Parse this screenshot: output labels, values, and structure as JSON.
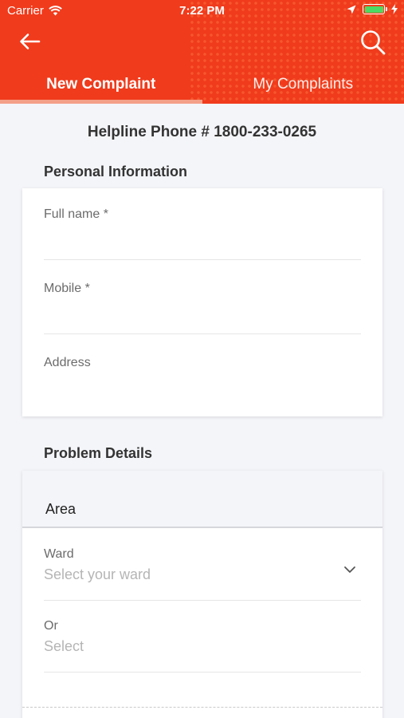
{
  "status_bar": {
    "carrier": "Carrier",
    "time": "7:22 PM",
    "icons": [
      "wifi-icon",
      "location-arrow-icon",
      "battery-icon",
      "charging-bolt-icon"
    ],
    "battery_color": "#4cd964"
  },
  "header": {
    "back_icon": "arrow-left-icon",
    "search_icon": "search-icon",
    "background_color": "#f03b1c"
  },
  "tabs": [
    {
      "label": "New Complaint",
      "active": true
    },
    {
      "label": "My Complaints",
      "active": false
    }
  ],
  "helpline": "Helpline Phone # 1800-233-0265",
  "personal_info": {
    "title": "Personal Information",
    "fields": [
      {
        "label": "Full name *",
        "value": ""
      },
      {
        "label": "Mobile *",
        "value": ""
      },
      {
        "label": "Address",
        "value": ""
      }
    ]
  },
  "problem_details": {
    "title": "Problem Details",
    "area_title": "Area",
    "ward": {
      "label": "Ward",
      "placeholder": "Select your ward"
    },
    "or_select": {
      "label": "Or",
      "placeholder": "Select"
    }
  }
}
